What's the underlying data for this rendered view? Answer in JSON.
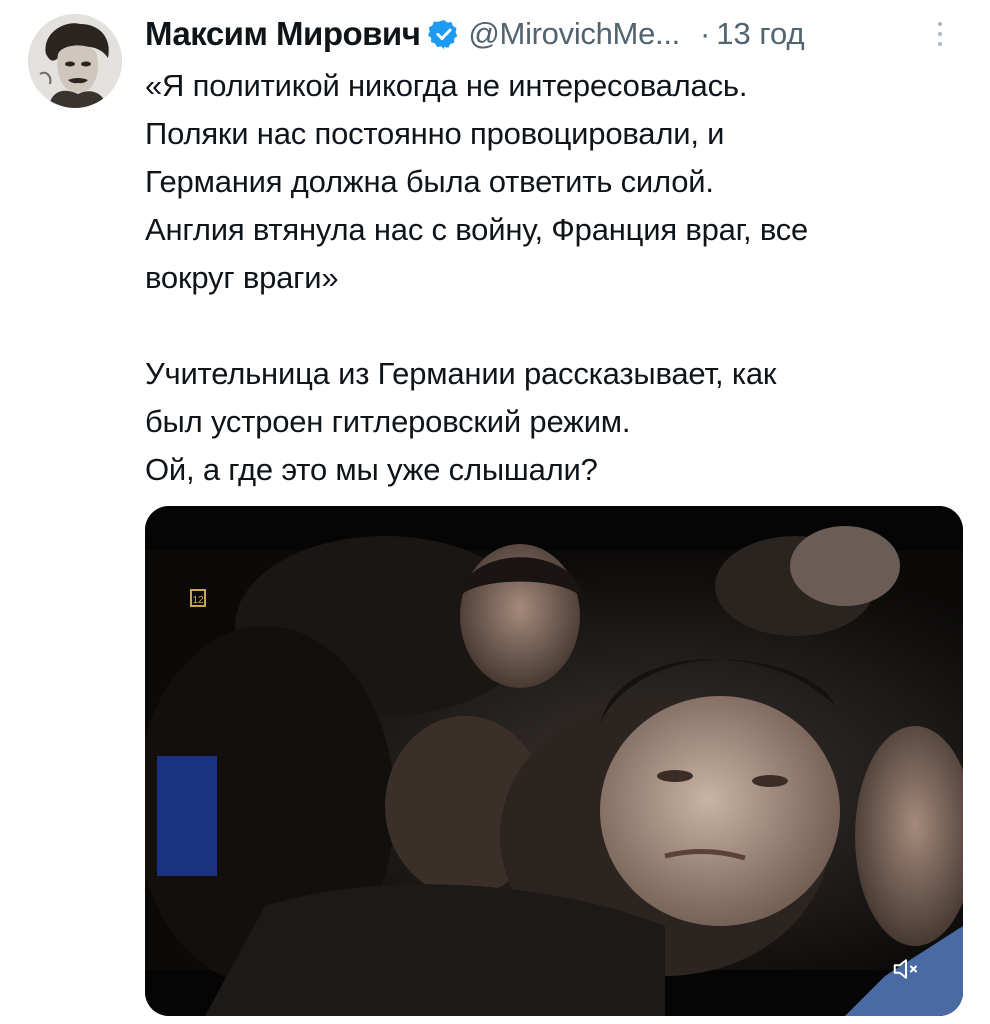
{
  "tweet": {
    "author_name": "Максим Мирович",
    "handle": "@MirovichMe...",
    "separator": "·",
    "time": "13 год",
    "text_lines": [
      "«Я политикой никогда не интересовалась.",
      "Поляки нас постоянно провоцировали, и",
      "Германия должна была ответить силой.",
      "Англия втянула нас с войну, Франция враг, все",
      "вокруг враги»",
      "",
      "Учительница из Германии рассказывает, как",
      "был устроен гитлеровский режим.",
      "Ой, а где это мы уже слышали?"
    ]
  },
  "media": {
    "rating_badge": "12",
    "muted": true
  },
  "icons": {
    "verified": "verified-badge-icon",
    "more": "more-vertical-icon",
    "mute": "speaker-muted-icon"
  },
  "colors": {
    "text": "#0f1419",
    "secondary": "#536471",
    "verified": "#1d9bf0",
    "media_bg": "#050505"
  }
}
